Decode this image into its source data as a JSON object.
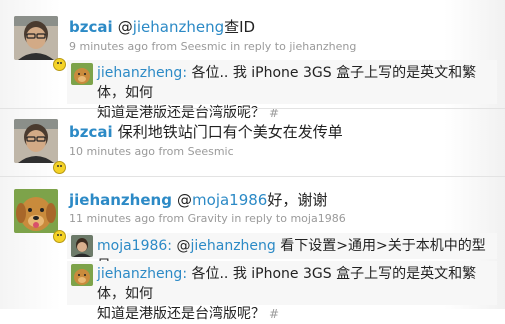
{
  "tweets": [
    {
      "user": "bzcai",
      "text_prefix": "@",
      "mention": "jiehanzheng",
      "text_suffix": "查ID",
      "time": "9 minutes ago",
      "from_label": "from",
      "source": "Seesmic",
      "reply_label": "in reply to",
      "reply_to": "jiehanzheng",
      "quote": {
        "user": "jiehanzheng:",
        "line1": "各位.. 我 iPhone 3GS 盒子上写的是英文和繁体，如何",
        "line2": "知道是港版还是台湾版呢？",
        "hash": "#"
      }
    },
    {
      "user": "bzcai",
      "text": "保利地铁站门口有个美女在发传单",
      "time": "10 minutes ago",
      "from_label": "from",
      "source": "Seesmic"
    },
    {
      "user": "jiehanzheng",
      "text_prefix": "@",
      "mention": "moja1986",
      "text_suffix": "好，谢谢",
      "time": "11 minutes ago",
      "from_label": "from",
      "source": "Gravity",
      "reply_label": "in reply to",
      "reply_to": "moja1986",
      "quote1": {
        "user": "moja1986:",
        "mention_prefix": "@",
        "mention": "jiehanzheng",
        "text": "看下设置>通用>关于本机中的型号",
        "hash": "#"
      },
      "quote2": {
        "user": "jiehanzheng:",
        "line1": "各位.. 我 iPhone 3GS 盒子上写的是英文和繁体，如何",
        "line2": "知道是港版还是台湾版呢？",
        "hash": "#"
      }
    }
  ]
}
